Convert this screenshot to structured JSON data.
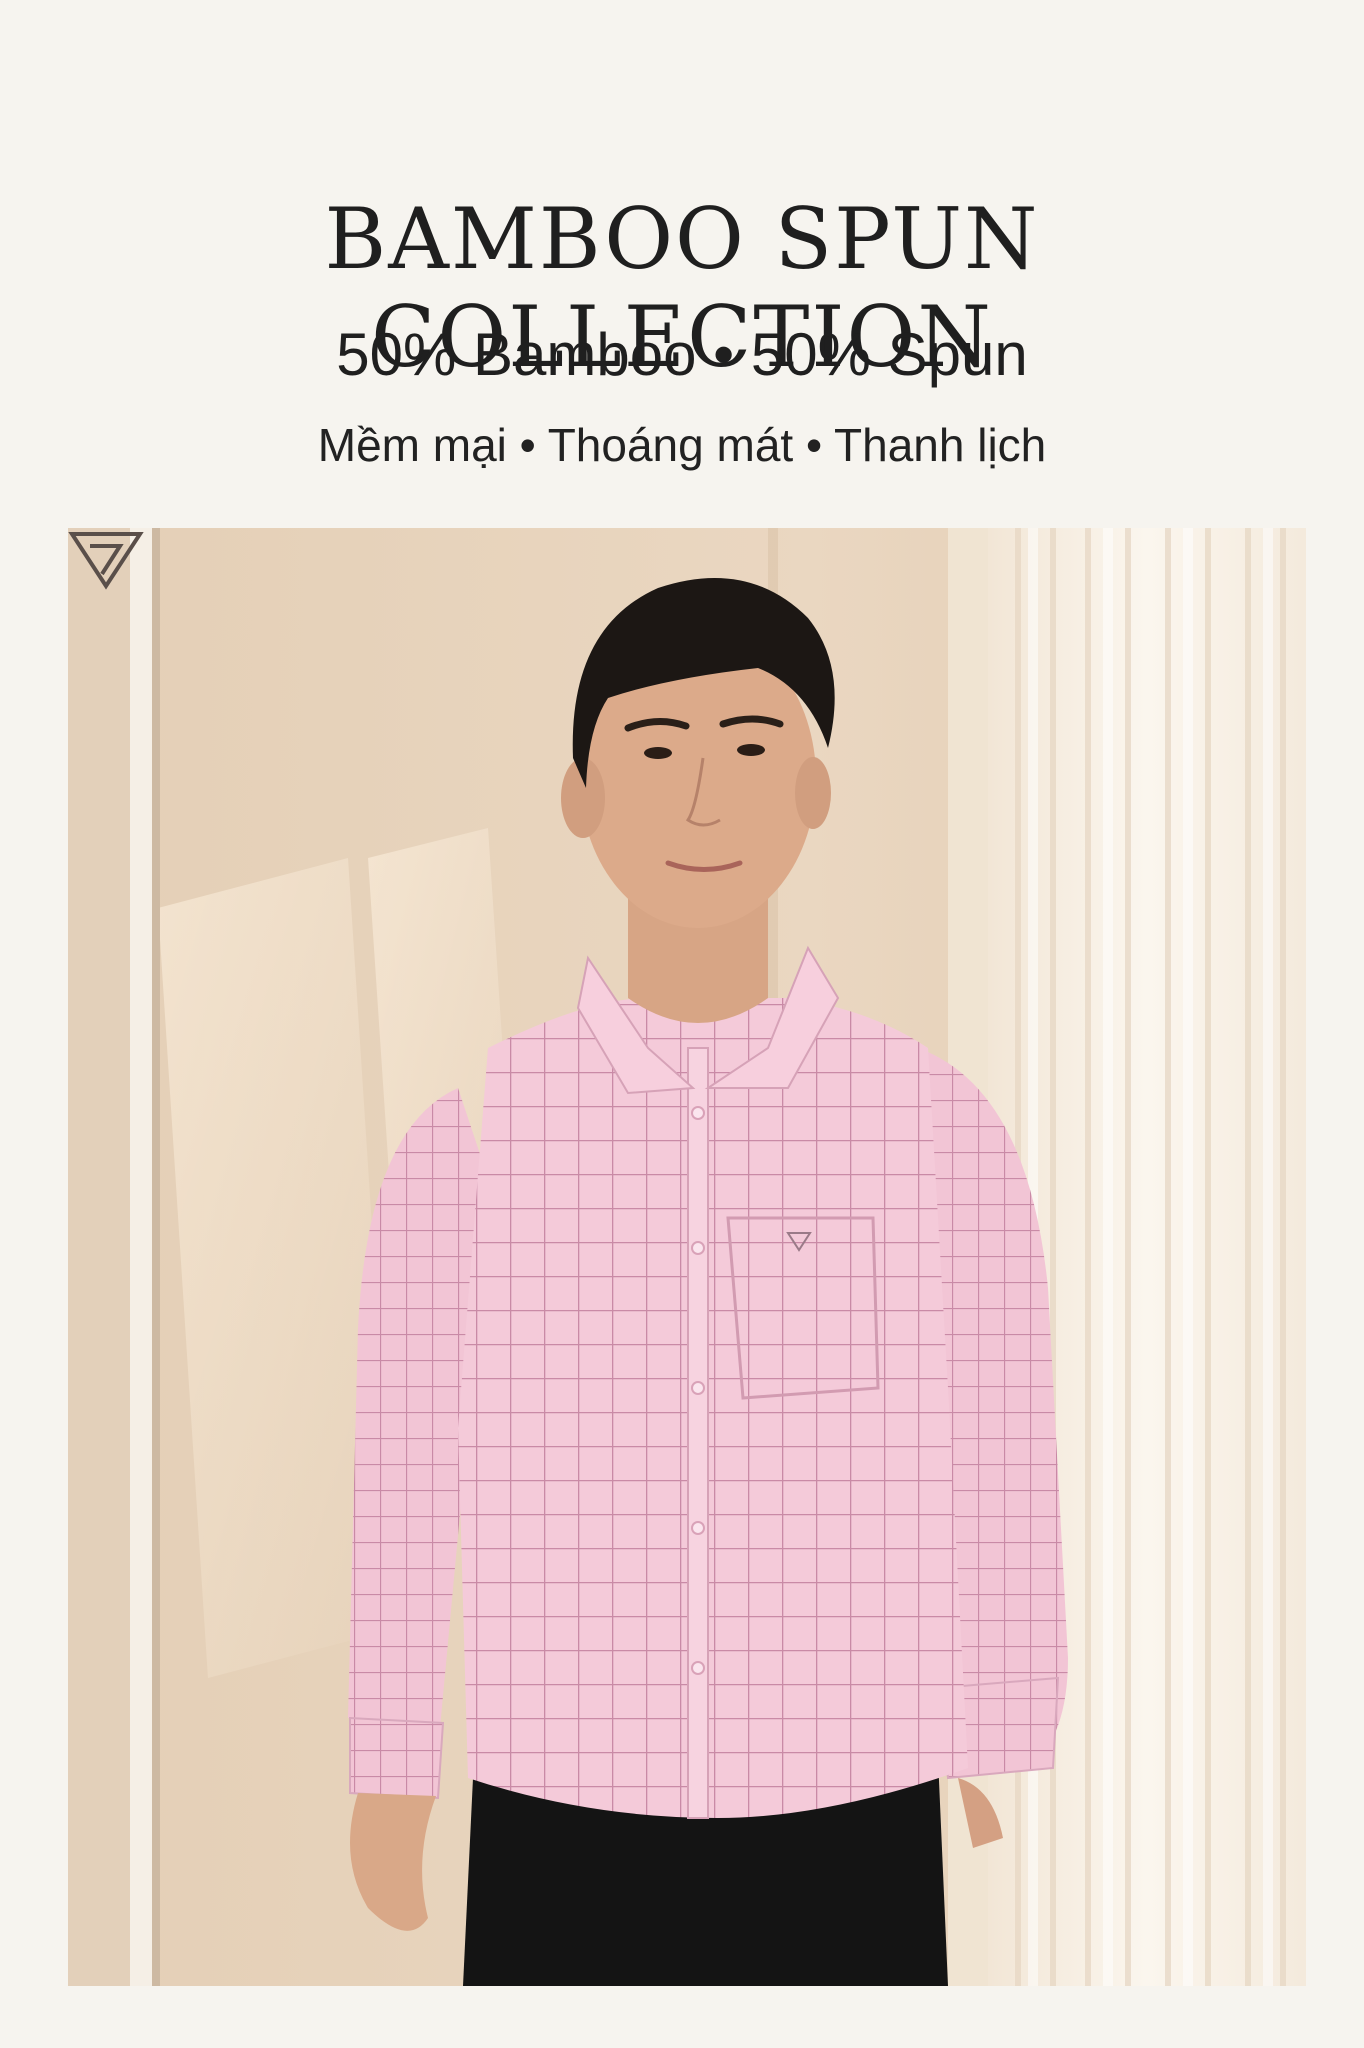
{
  "header": {
    "title": "BAMBOO SPUN COLLECTION",
    "subtitle": "50% Bamboo • 50% Spun",
    "tagline": "Mềm mại • Thoáng mát • Thanh lịch"
  },
  "photo": {
    "subject": "model-pink-checked-shirt",
    "shirt_color": "#f4c9d8",
    "check_color": "#c98aa6",
    "trouser_color": "#141414",
    "wall_color": "#e8d4bd",
    "curtain_color": "#f7efe4"
  },
  "brand": {
    "logo_icon": "triangle-monogram-icon"
  }
}
